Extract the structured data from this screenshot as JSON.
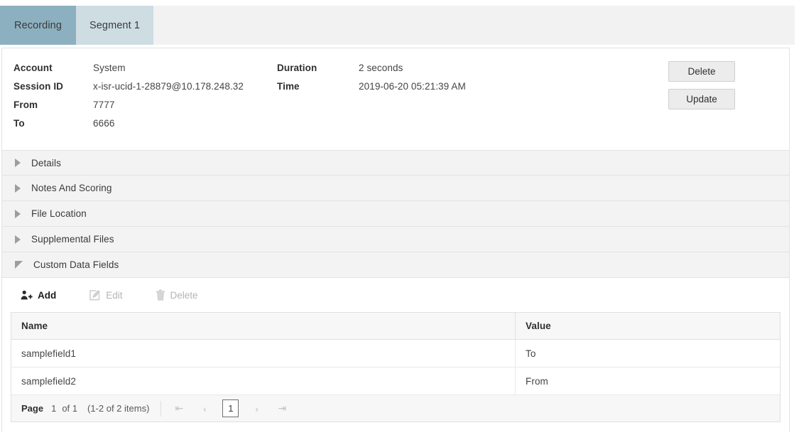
{
  "tabs": [
    {
      "label": "Recording",
      "active": true
    },
    {
      "label": "Segment 1",
      "active": false
    }
  ],
  "summary": {
    "left": [
      {
        "key": "Account",
        "value": "System"
      },
      {
        "key": "Session ID",
        "value": "x-isr-ucid-1-28879@10.178.248.32"
      },
      {
        "key": "From",
        "value": "7777"
      },
      {
        "key": "To",
        "value": "6666"
      }
    ],
    "right": [
      {
        "key": "Duration",
        "value": "2 seconds"
      },
      {
        "key": "Time",
        "value": "2019-06-20 05:21:39 AM"
      }
    ],
    "buttons": {
      "delete": "Delete",
      "update": "Update"
    }
  },
  "accordion": [
    {
      "label": "Details",
      "expanded": false
    },
    {
      "label": "Notes And Scoring",
      "expanded": false
    },
    {
      "label": "File Location",
      "expanded": false
    },
    {
      "label": "Supplemental Files",
      "expanded": false
    },
    {
      "label": "Custom Data Fields",
      "expanded": true
    }
  ],
  "custom_data_fields": {
    "toolbar": [
      {
        "label": "Add",
        "icon": "add-user-icon",
        "enabled": true
      },
      {
        "label": "Edit",
        "icon": "pencil-icon",
        "enabled": false
      },
      {
        "label": "Delete",
        "icon": "trash-icon",
        "enabled": false
      }
    ],
    "grid": {
      "columns": [
        "Name",
        "Value"
      ],
      "rows": [
        {
          "name": "samplefield1",
          "value": "To"
        },
        {
          "name": "samplefield2",
          "value": "From"
        }
      ]
    },
    "pager": {
      "page_label": "Page",
      "page_number": "1",
      "of_text": "of 1",
      "items_text": "(1-2 of 2 items)",
      "first_icon": "first-page-icon",
      "prev_icon": "previous-page-icon",
      "current_page": "1",
      "next_icon": "next-page-icon",
      "last_icon": "last-page-icon"
    }
  },
  "colors": {
    "tab_active": "#8cb0c0",
    "tab_inactive": "#cddde2",
    "strip_bg": "#f2f2f2",
    "accordion_bg": "#f3f3f3",
    "grid_head_bg": "#f7f7f7"
  }
}
